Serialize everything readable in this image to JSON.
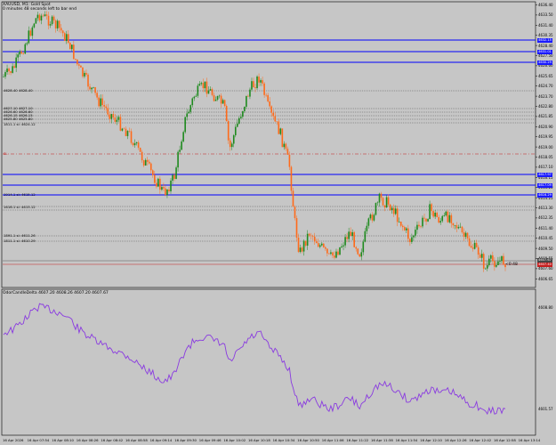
{
  "chart": {
    "title": "XAUUSD, M1:  Gold Spot",
    "countdown": "0 minutes 48 seconds left to bar end",
    "timer_label": "<0:48",
    "indicator_title": "OdorCandleDelta  4607.20  4608.26  4607.20  4607.67",
    "colors": {
      "up": "#1e8a1e",
      "down": "#ff6a1a",
      "level": "#0000ff",
      "indicator": "#8a3be0",
      "price_line": "#c41e1e",
      "background": "#c6c6c6"
    },
    "price_axis": [
      "4636.40",
      "4633.50",
      "4631.40",
      "4630.35",
      "4628.40",
      "4627.50",
      "4626.60",
      "4625.65",
      "4624.70",
      "4623.70",
      "4622.80",
      "4621.85",
      "4620.90",
      "4619.95",
      "4619.00",
      "4618.05",
      "4617.10",
      "4616.15",
      "4615.20",
      "4614.25",
      "4613.30",
      "4612.35",
      "4611.40",
      "4610.45",
      "4609.50",
      "4608.55",
      "4607.60",
      "4606.65"
    ],
    "tags": [
      {
        "label": "4632.15",
        "type": "blue"
      },
      {
        "label": "4631.01",
        "type": "blue"
      },
      {
        "label": "4630.29",
        "type": "blue"
      },
      {
        "label": "4617.97",
        "type": "blue"
      },
      {
        "label": "4617.09",
        "type": "blue"
      },
      {
        "label": "4616.29",
        "type": "blue"
      },
      {
        "label": "4607.67",
        "type": "dark"
      },
      {
        "label": "4607.40",
        "type": "red"
      }
    ],
    "level_labels": [
      "4628.40 4628.40",
      "4627.10 4627.10",
      "4626.60 4626.60",
      "4626.15 4626.15",
      "4625.80 4625.80",
      "1811.1 sl: 4624.12",
      "1914.1 sl: 4615.12",
      "1616.1 sl: 4615.12",
      "1891.1 sl: 4611.26",
      "1811.1 sl: 4610.29"
    ],
    "left_marker": "SL",
    "indicator_axis": [
      "4608.80",
      "4601.57"
    ],
    "time_axis": [
      "16 Apr 2026",
      "16 Apr 07:54",
      "16 Apr 08:10",
      "16 Apr 08:26",
      "16 Apr 08:42",
      "16 Apr 08:58",
      "16 Apr 09:14",
      "16 Apr 09:30",
      "16 Apr 09:46",
      "16 Apr 10:02",
      "16 Apr 10:18",
      "16 Apr 10:34",
      "16 Apr 10:50",
      "16 Apr 11:06",
      "16 Apr 11:22",
      "16 Apr 11:38",
      "16 Apr 11:54",
      "16 Apr 12:10",
      "16 Apr 12:26",
      "16 Apr 12:42",
      "16 Apr 12:58",
      "16 Apr 13:14"
    ],
    "series_path": [
      [
        0.0,
        0.25
      ],
      [
        0.02,
        0.22
      ],
      [
        0.03,
        0.18
      ],
      [
        0.05,
        0.1
      ],
      [
        0.06,
        0.05
      ],
      [
        0.07,
        0.02
      ],
      [
        0.09,
        0.04
      ],
      [
        0.11,
        0.07
      ],
      [
        0.13,
        0.12
      ],
      [
        0.15,
        0.22
      ],
      [
        0.17,
        0.28
      ],
      [
        0.19,
        0.34
      ],
      [
        0.22,
        0.4
      ],
      [
        0.25,
        0.46
      ],
      [
        0.28,
        0.56
      ],
      [
        0.3,
        0.62
      ],
      [
        0.32,
        0.68
      ],
      [
        0.34,
        0.62
      ],
      [
        0.36,
        0.42
      ],
      [
        0.38,
        0.32
      ],
      [
        0.4,
        0.28
      ],
      [
        0.42,
        0.32
      ],
      [
        0.44,
        0.36
      ],
      [
        0.45,
        0.52
      ],
      [
        0.47,
        0.4
      ],
      [
        0.49,
        0.3
      ],
      [
        0.51,
        0.25
      ],
      [
        0.53,
        0.38
      ],
      [
        0.55,
        0.45
      ],
      [
        0.57,
        0.58
      ],
      [
        0.58,
        0.78
      ],
      [
        0.59,
        0.9
      ],
      [
        0.61,
        0.82
      ],
      [
        0.63,
        0.87
      ],
      [
        0.65,
        0.92
      ],
      [
        0.67,
        0.88
      ],
      [
        0.69,
        0.82
      ],
      [
        0.71,
        0.9
      ],
      [
        0.73,
        0.78
      ],
      [
        0.75,
        0.7
      ],
      [
        0.77,
        0.72
      ],
      [
        0.79,
        0.78
      ],
      [
        0.81,
        0.85
      ],
      [
        0.83,
        0.8
      ],
      [
        0.85,
        0.74
      ],
      [
        0.87,
        0.78
      ],
      [
        0.89,
        0.76
      ],
      [
        0.91,
        0.82
      ],
      [
        0.93,
        0.87
      ],
      [
        0.95,
        0.9
      ],
      [
        0.96,
        0.96
      ],
      [
        0.97,
        0.93
      ]
    ]
  }
}
